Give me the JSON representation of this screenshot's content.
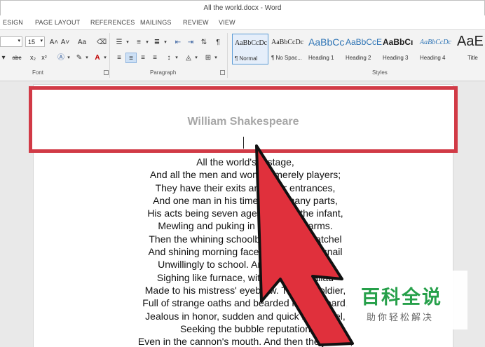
{
  "window": {
    "title": "All the world.docx - Word"
  },
  "ribbon_tabs": [
    "ESIGN",
    "PAGE LAYOUT",
    "REFERENCES",
    "MAILINGS",
    "REVIEW",
    "VIEW"
  ],
  "font_group": {
    "label": "Font",
    "font_size": "15",
    "grow_label": "A˄",
    "shrink_label": "A˅",
    "case_label": "Aa",
    "strike_label": "abc",
    "sub_label": "x₂",
    "sup_label": "x²"
  },
  "paragraph_group": {
    "label": "Paragraph"
  },
  "styles_group": {
    "label": "Styles",
    "items": [
      {
        "sample": "AaBbCcDc",
        "name": "¶ Normal"
      },
      {
        "sample": "AaBbCcDc",
        "name": "¶ No Spac..."
      },
      {
        "sample": "AaBbCc",
        "name": "Heading 1"
      },
      {
        "sample": "AaBbCcE",
        "name": "Heading 2"
      },
      {
        "sample": "AaBbCı",
        "name": "Heading 3"
      },
      {
        "sample": "AaBbCcDc",
        "name": "Heading 4"
      },
      {
        "sample": "AaE",
        "name": "Title"
      }
    ]
  },
  "document": {
    "heading": "William Shakespeare",
    "lines": [
      "All the world's a stage,",
      "And all the men and women merely players;",
      "They have their exits and their entrances,",
      "And one man in his time plays many parts,",
      "His acts being seven ages. At first, the infant,",
      "Mewling and puking in the nurse's arms.",
      "Then the whining schoolboy, with his satchel",
      "And shining morning face, creeping like snail",
      "Unwillingly to school. And then the lover,",
      "Sighing like furnace, with a woeful ballad",
      "Made to his mistress' eyebrow. Then a soldier,",
      "Full of strange oaths and bearded like the pard,",
      "Jealous in honor, sudden and quick in quarrel,",
      "Seeking the bubble reputation",
      "Even in the cannon's mouth. And then the justice,"
    ]
  },
  "watermark": {
    "main": "百科全说",
    "sub": "助你轻松解决"
  },
  "colors": {
    "highlight_border": "#d13a46",
    "arrow": "#e0303c",
    "watermark_green": "#26a04a"
  }
}
